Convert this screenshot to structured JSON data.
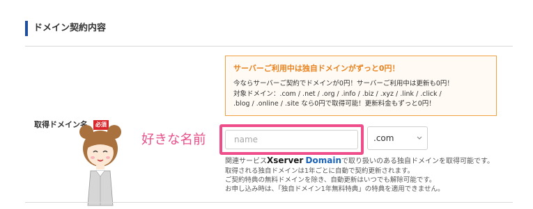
{
  "section": {
    "title": "ドメイン契約内容"
  },
  "field": {
    "label": "取得ドメイン名",
    "required_badge": "必須"
  },
  "notice": {
    "heading": "サーバーご利用中は独自ドメインがずっと0円！",
    "lines": [
      "今ならサーバーご契約でドメインが0円！サーバーご利用中は更新も0円！",
      "対象ドメイン：.com / .net / .org / .info / .biz / .xyz / .link / .click /",
      ".blog / .online / .site なら0円で取得可能！更新料金もずっと0円！"
    ]
  },
  "callout": {
    "text": "好きな名前"
  },
  "name_input": {
    "placeholder": "name",
    "value": ""
  },
  "tld_select": {
    "selected": ".com"
  },
  "help": {
    "prefix": "関連サービス",
    "brand_x": "Xserver",
    "brand_domain": "Domain",
    "suffix": "で取り扱いのある独自ドメインを取得可能です。",
    "lines": [
      "取得される独自ドメインは1年ごとに自動で契約更新されます。",
      "ご契約特典の無料ドメインを除き、自動更新はいつでも解除可能です。",
      "お申し込み時は、「独自ドメイン1年無料特典」の特典を適用できません。"
    ]
  },
  "colors": {
    "accent_blue": "#1f4f9c",
    "required_red": "#d9262c",
    "notice_orange": "#e8821e",
    "highlight_pink": "#ef4d8a",
    "brand_blue": "#1a62b8"
  },
  "icons": {
    "select_caret": "chevron-down-icon",
    "mascot": "mascot-girl-illustration"
  }
}
